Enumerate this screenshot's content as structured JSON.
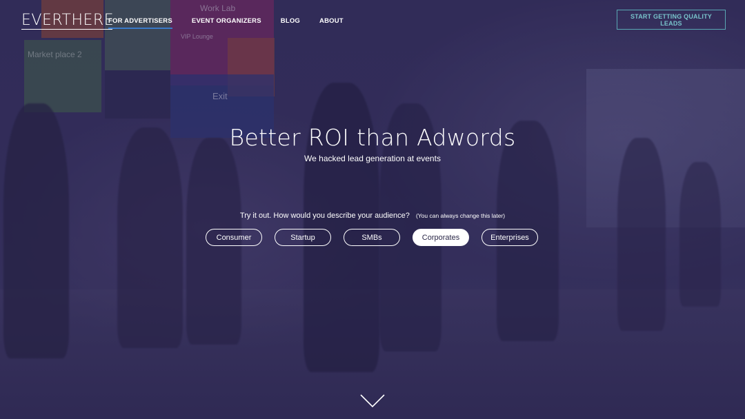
{
  "brand": {
    "logo": "EVERTHERE"
  },
  "nav": {
    "items": [
      {
        "label": "FOR ADVERTISERS",
        "active": true
      },
      {
        "label": "EVENT ORGANIZERS",
        "active": false
      },
      {
        "label": "BLOG",
        "active": false
      },
      {
        "label": "ABOUT",
        "active": false
      }
    ],
    "cta_label": "START GETTING QUALITY LEADS"
  },
  "hero": {
    "title": "Better ROI than Adwords",
    "subtitle": "We hacked lead generation at events",
    "prompt": "Try it out. How would you describe your audience?",
    "prompt_hint": "(You can always change this later)",
    "options": [
      "Consumer",
      "Startup",
      "SMBs",
      "Corporates",
      "Enterprises"
    ],
    "selected_option": "Corporates"
  },
  "background_signs": {
    "exit": "Exit",
    "marketplace": "Market place 2",
    "work_lab": "Work Lab",
    "vip": "VIP Lounge"
  },
  "colors": {
    "overlay": "#2e2a4e",
    "cta_border": "#5aa8b4",
    "nav_active_underline": "#3a7ac9",
    "sign_green": "#4f7a4a",
    "sign_pink": "#9a2e6a",
    "sign_blue": "#2f3f86",
    "sign_orange": "#b2572e"
  },
  "icons": {
    "scroll": "chevron-down-icon"
  }
}
